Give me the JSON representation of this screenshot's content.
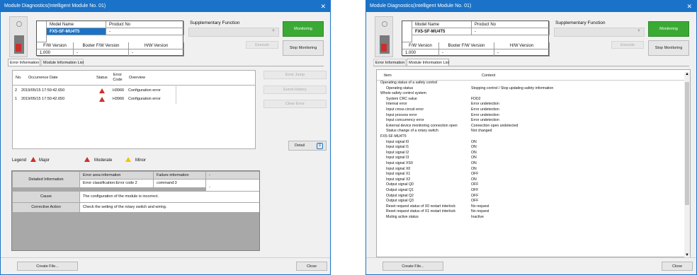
{
  "window1": {
    "title": "Module Diagnostics(Intelligent Module No. 01)",
    "close_glyph": "✕",
    "info": {
      "model_name_label": "Model Name",
      "product_no_label": "Product No",
      "model_name_value": "FX5-SF-MU4T5",
      "product_no_value": "-",
      "fw_label": "F/W Version",
      "boot_label": "Booter F/W Version",
      "hw_label": "H/W Version",
      "fw_value": "1.000",
      "boot_value": "-",
      "hw_value": "-"
    },
    "supplementary_label": "Supplementary Function",
    "supplementary_arrow": "▼",
    "execute_label": "Execute",
    "monitoring_label": "Monitoring",
    "stop_label": "Stop Monitoring",
    "tabs": [
      "Error Information",
      "Module Information List"
    ],
    "error_headers": {
      "no": "No.",
      "date": "Occurrence Date",
      "status": "Status",
      "code": "Error Code",
      "overview": "Overview"
    },
    "errors": [
      {
        "no": "2",
        "date": "2019/05/15 17:50:42.650",
        "code": "H3966",
        "overview": "Configuration error"
      },
      {
        "no": "1",
        "date": "2019/05/15 17:50:42.650",
        "code": "H3966",
        "overview": "Configuration error"
      }
    ],
    "side_buttons": [
      "Error Jump",
      "Event History",
      "Clear Error"
    ],
    "detail_button": "Detail",
    "legend": {
      "title": "Legend",
      "major": "Major",
      "moderate": "Moderate",
      "minor": "Minor"
    },
    "detail": {
      "detailed_info_label": "Detailed Information",
      "area_label": "Error area information",
      "area_value": "Error classification:Error code 2",
      "failure_label": "Failure information",
      "failure_value": "command:3",
      "dash_top": "-",
      "dash_side": "-",
      "cause_label": "Cause",
      "cause_value": "The configuration of the module is incorrect.",
      "action_label": "Corrective Action",
      "action_value": "Check the setting of the rotary switch and wiring."
    },
    "create_file": "Create File...",
    "close": "Close"
  },
  "window2": {
    "title": "Module Diagnostics(Intelligent Module No. 01)",
    "close_glyph": "✕",
    "info": {
      "model_name_label": "Model Name",
      "product_no_label": "Product No",
      "model_name_value": "FX5-SF-MU4T5",
      "product_no_value": "-",
      "fw_label": "F/W Version",
      "boot_label": "Booter F/W Version",
      "hw_label": "H/W Version",
      "fw_value": "1.000",
      "boot_value": "-",
      "hw_value": "-"
    },
    "supplementary_label": "Supplementary Function",
    "supplementary_arrow": "▼",
    "execute_label": "Execute",
    "monitoring_label": "Monitoring",
    "stop_label": "Stop Monitoring",
    "tabs": [
      "Error Information",
      "Module Information List"
    ],
    "list_headers": {
      "item": "Item",
      "content": "Content"
    },
    "list_rows": [
      {
        "item": "Operating status of a safety control",
        "content": "",
        "indent": 0
      },
      {
        "item": "Operating status",
        "content": "Stopping control / Stop updating safety information",
        "indent": 1
      },
      {
        "item": "Whole safety control system",
        "content": "",
        "indent": 0
      },
      {
        "item": "System CRC value",
        "content": "FDD2",
        "indent": 1
      },
      {
        "item": "Internal error",
        "content": "Error undetection",
        "indent": 1
      },
      {
        "item": "Input cross-circuit error",
        "content": "Error undetection",
        "indent": 1
      },
      {
        "item": "Input process error",
        "content": "Error undetection",
        "indent": 1
      },
      {
        "item": "Input concurrency error",
        "content": "Error undetection",
        "indent": 1
      },
      {
        "item": "External device monitoring connection open",
        "content": "Connection open undetected",
        "indent": 1
      },
      {
        "item": "Status change of a rotary switch",
        "content": "Not changed",
        "indent": 1
      },
      {
        "item": "FX5-SF-MU4T5",
        "content": "",
        "indent": 0
      },
      {
        "item": "Input signal I0",
        "content": "ON",
        "indent": 1
      },
      {
        "item": "Input signal I1",
        "content": "ON",
        "indent": 1
      },
      {
        "item": "Input signal I2",
        "content": "ON",
        "indent": 1
      },
      {
        "item": "Input signal I3",
        "content": "ON",
        "indent": 1
      },
      {
        "item": "Input signal XS0",
        "content": "ON",
        "indent": 1
      },
      {
        "item": "Input signal X0",
        "content": "ON",
        "indent": 1
      },
      {
        "item": "Input signal X1",
        "content": "OFF",
        "indent": 1
      },
      {
        "item": "Input signal X2",
        "content": "ON",
        "indent": 1
      },
      {
        "item": "Output signal Q0",
        "content": "OFF",
        "indent": 1
      },
      {
        "item": "Output signal Q1",
        "content": "OFF",
        "indent": 1
      },
      {
        "item": "Output signal Q2",
        "content": "OFF",
        "indent": 1
      },
      {
        "item": "Output signal Q3",
        "content": "OFF",
        "indent": 1
      },
      {
        "item": "Reset request status of X0 restart interlock",
        "content": "No request",
        "indent": 1
      },
      {
        "item": "Reset request status of X1 restart interlock",
        "content": "No request",
        "indent": 1
      },
      {
        "item": "Muting active status",
        "content": "Inactive",
        "indent": 1
      }
    ],
    "scroll_up": "▲",
    "scroll_down": "▼",
    "create_file": "Create File...",
    "close": "Close"
  },
  "colors": {
    "titlebar": "#1a73c8",
    "monitoring": "#3aaa35",
    "major": "#c9302c",
    "minor": "#f2c400"
  }
}
